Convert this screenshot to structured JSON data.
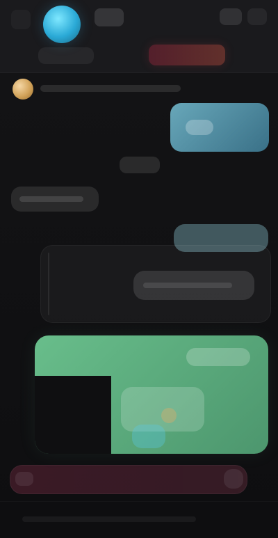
{
  "app": {
    "colors": {
      "background": "#0d0d0f",
      "header": "#1a1a1d",
      "accent_blue": "#2aa9d6",
      "accent_green": "#78dca0",
      "accent_red": "#d24a5a"
    }
  }
}
